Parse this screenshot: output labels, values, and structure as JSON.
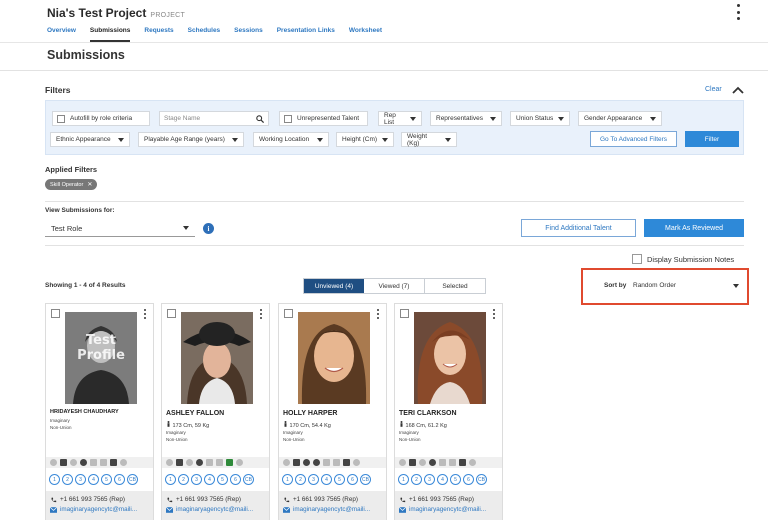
{
  "project": {
    "title": "Nia's Test Project",
    "tag": "PROJECT"
  },
  "tabs": [
    {
      "label": "Overview"
    },
    {
      "label": "Submissions"
    },
    {
      "label": "Requests"
    },
    {
      "label": "Schedules"
    },
    {
      "label": "Sessions"
    },
    {
      "label": "Presentation Links"
    },
    {
      "label": "Worksheet"
    }
  ],
  "page": {
    "title": "Submissions"
  },
  "filters": {
    "label": "Filters",
    "clear": "Clear",
    "autofill": "Autofill by role criteria",
    "stage_name_placeholder": "Stage Name",
    "unrepresented": "Unrepresented Talent",
    "rep_list": "Rep List",
    "representatives": "Representatives",
    "union_status": "Union Status",
    "gender": "Gender Appearance",
    "ethnic": "Ethnic Appearance",
    "age_range": "Playable Age Range (years)",
    "working_location": "Working Location",
    "height": "Height (Cm)",
    "weight": "Weight (Kg)",
    "advanced": "Go To Advanced Filters",
    "filter_btn": "Filter"
  },
  "applied": {
    "label": "Applied Filters",
    "chip": "Skill Operator"
  },
  "view_for": {
    "label": "View Submissions for:",
    "role": "Test Role"
  },
  "actions": {
    "find": "Find Additional Talent",
    "review": "Mark As Reviewed"
  },
  "display_notes": "Display Submission Notes",
  "results": {
    "showing": "Showing 1 - 4 of 4 Results"
  },
  "segments": {
    "unviewed": "Unviewed (4)",
    "viewed": "Viewed (7)",
    "selected": "Selected"
  },
  "sort": {
    "label": "Sort by",
    "value": "Random Order"
  },
  "cards": [
    {
      "name": "HRIDAYESH CHAUDHARY",
      "meta": "",
      "agency": "Imaginary",
      "union": "Non-Union",
      "phone": "+1 661 993 7565 (Rep)",
      "email": "imaginaryagencytc@maili..."
    },
    {
      "name": "ASHLEY FALLON",
      "meta": "173 Cm, 59 Kg",
      "agency": "Imaginary",
      "union": "Non-Union",
      "phone": "+1 661 993 7565 (Rep)",
      "email": "imaginaryagencytc@maili..."
    },
    {
      "name": "HOLLY HARPER",
      "meta": "170 Cm, 54.4 Kg",
      "agency": "Imaginary",
      "union": "Non-Union",
      "phone": "+1 661 993 7565 (Rep)",
      "email": "imaginaryagencytc@maili..."
    },
    {
      "name": "TERI CLARKSON",
      "meta": "168 Cm, 61.2 Kg",
      "agency": "Imaginary",
      "union": "Non-Union",
      "phone": "+1 661 993 7565 (Rep)",
      "email": "imaginaryagencytc@maili..."
    }
  ],
  "numbers": [
    "1",
    "2",
    "3",
    "4",
    "5",
    "6",
    "CB"
  ],
  "photo_overlay": {
    "line1": "Test",
    "line2": "Profile"
  },
  "colors": {
    "accent": "#2e89d8",
    "link": "#2e78c1",
    "highlight": "#e04a2f",
    "segment_active": "#1f4e82"
  },
  "icons": [
    "kebab-icon",
    "search-icon",
    "chevron-up-icon",
    "info-icon",
    "phone-icon",
    "mail-icon",
    "height-icon"
  ]
}
